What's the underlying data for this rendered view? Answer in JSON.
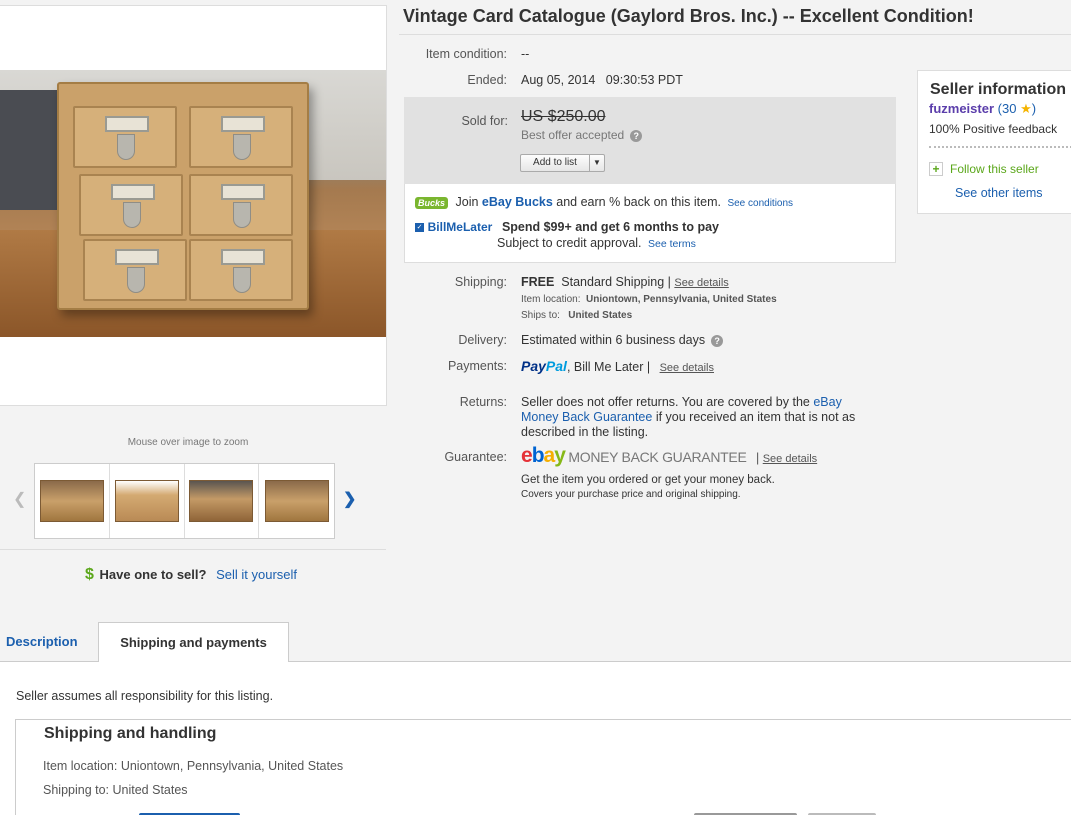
{
  "listing": {
    "title": "Vintage Card Catalogue (Gaylord Bros. Inc.) -- Excellent Condition!"
  },
  "gallery": {
    "zoom_hint": "Mouse over image to zoom",
    "prev_icon": "chevron-left-icon",
    "next_icon": "chevron-right-icon"
  },
  "sell": {
    "symbol": "$",
    "question": "Have one to sell?",
    "link": "Sell it yourself"
  },
  "details": {
    "condition_label": "Item condition:",
    "condition_value": "--",
    "ended_label": "Ended:",
    "ended_value": "Aug 05, 2014   09:30:53 PDT",
    "sold_label": "Sold for:",
    "sold_price": "US $250.00",
    "best_offer": "Best offer accepted",
    "add_to_list": "Add to list"
  },
  "promos": {
    "bucks_badge": "Bucks",
    "bucks_join": "Join",
    "bucks_brand": "eBay Bucks",
    "bucks_text": "and earn % back on this item.",
    "bucks_link": "See conditions",
    "bml_logo": "BillMeLater",
    "bml_headline": "Spend $99+ and get 6 months to pay",
    "bml_sub": "Subject to credit approval.",
    "bml_link": "See terms"
  },
  "shipping_info": {
    "shipping_label": "Shipping:",
    "free": "FREE",
    "service": "Standard Shipping |",
    "see_details": "See details",
    "location_label": "Item location:",
    "location_value": "Uniontown, Pennsylvania, United States",
    "ships_label": "Ships to:",
    "ships_value": "United States",
    "delivery_label": "Delivery:",
    "delivery_value": "Estimated within 6 business days",
    "payments_label": "Payments:",
    "paypal_1": "Pay",
    "paypal_2": "Pal",
    "payments_rest": ", Bill Me Later  |",
    "returns_label": "Returns:",
    "returns_text_1": "Seller does not offer returns. You are covered by the",
    "returns_link": "eBay Money Back Guarantee",
    "returns_text_2": "if you received an item that is not as described in the listing.",
    "guarantee_label": "Guarantee:",
    "mbg_text": "MONEY BACK GUARANTEE",
    "guarantee_sub_1": "Get the item you ordered or get your money back.",
    "guarantee_sub_2": "Covers your purchase price and original shipping."
  },
  "seller": {
    "title": "Seller information",
    "name": "fuzmeister",
    "score": "30",
    "feedback": "100% Positive feedback",
    "follow": "Follow this seller",
    "see_other": "See other items"
  },
  "tabs": {
    "description": "Description",
    "shipping": "Shipping and payments"
  },
  "lower": {
    "assumes": "Seller assumes all responsibility for this listing.",
    "sh_title": "Shipping and handling",
    "sh_location": "Item location: Uniontown, Pennsylvania, United States",
    "sh_to": "Shipping to: United States"
  },
  "colors": {
    "link": "#1b5fae",
    "seller_name": "#5b3eab",
    "green": "#5ba71b"
  }
}
